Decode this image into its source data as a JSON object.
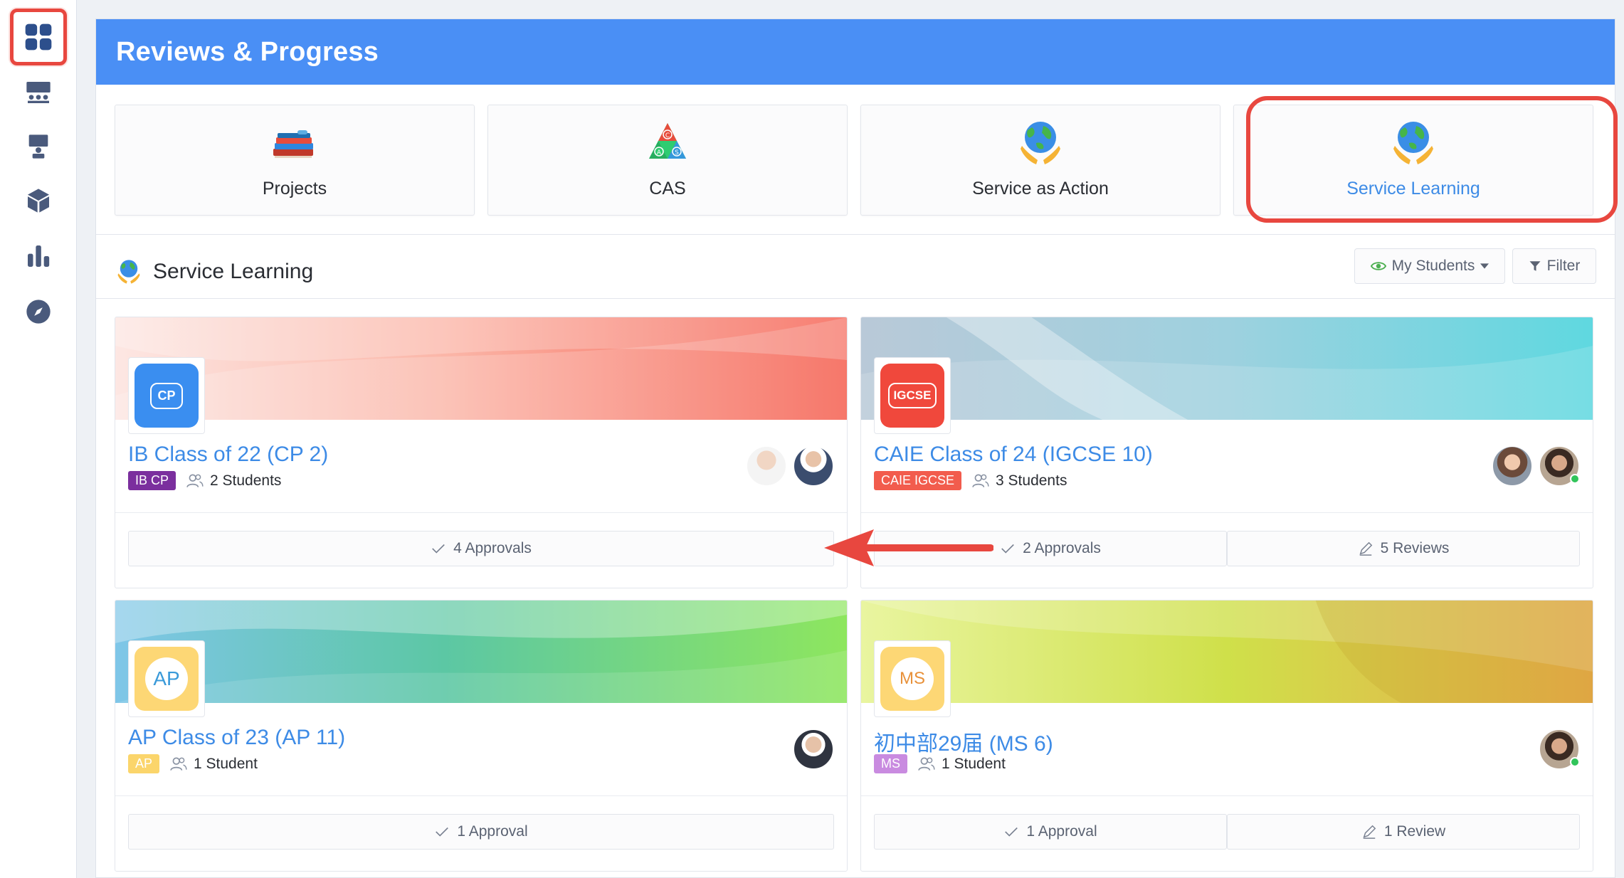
{
  "header": {
    "title": "Reviews & Progress"
  },
  "sidebar": {
    "items": [
      {
        "name": "dashboard",
        "icon": "grid-icon",
        "active": true
      },
      {
        "name": "classroom",
        "icon": "classroom-icon",
        "active": false
      },
      {
        "name": "presenter",
        "icon": "presenter-icon",
        "active": false
      },
      {
        "name": "resources",
        "icon": "cube-icon",
        "active": false
      },
      {
        "name": "reports",
        "icon": "bar-chart-icon",
        "active": false
      },
      {
        "name": "explore",
        "icon": "compass-icon",
        "active": false
      }
    ]
  },
  "tiles": [
    {
      "label": "Projects",
      "icon": "books-icon",
      "selected": false
    },
    {
      "label": "CAS",
      "icon": "cas-triangle-icon",
      "selected": false
    },
    {
      "label": "Service as Action",
      "icon": "globe-hands-icon",
      "selected": false
    },
    {
      "label": "Service Learning",
      "icon": "globe-hands-icon",
      "selected": true
    }
  ],
  "section": {
    "title": "Service Learning",
    "my_students_label": "My Students",
    "filter_label": "Filter"
  },
  "cards": [
    {
      "name": "IB Class of 22 (CP 2)",
      "logo_text": "CP",
      "badge": "IB CP",
      "badge_color": "#7b2f9e",
      "students": "2 Students",
      "actions": [
        "4 Approvals"
      ],
      "action_icons": [
        "check-icon"
      ]
    },
    {
      "name": "CAIE Class of 24 (IGCSE 10)",
      "logo_text": "IGCSE",
      "badge": "CAIE IGCSE",
      "badge_color": "#f25c4d",
      "students": "3 Students",
      "actions": [
        "2 Approvals",
        "5 Reviews"
      ],
      "action_icons": [
        "check-icon",
        "pencil-icon"
      ]
    },
    {
      "name": "AP Class of 23 (AP 11)",
      "logo_text": "AP",
      "badge": "AP",
      "badge_color": "#fbd56b",
      "students": "1 Student",
      "actions": [
        "1 Approval"
      ],
      "action_icons": [
        "check-icon"
      ]
    },
    {
      "name": "初中部29届 (MS 6)",
      "logo_text": "MS",
      "badge": "MS",
      "badge_color": "#c98be0",
      "students": "1 Student",
      "actions": [
        "1 Approval",
        "1 Review"
      ],
      "action_icons": [
        "check-icon",
        "pencil-icon"
      ]
    }
  ],
  "colors": {
    "header_bg": "#4a8ff5",
    "link": "#3d8be6",
    "highlight": "#e8473f"
  }
}
